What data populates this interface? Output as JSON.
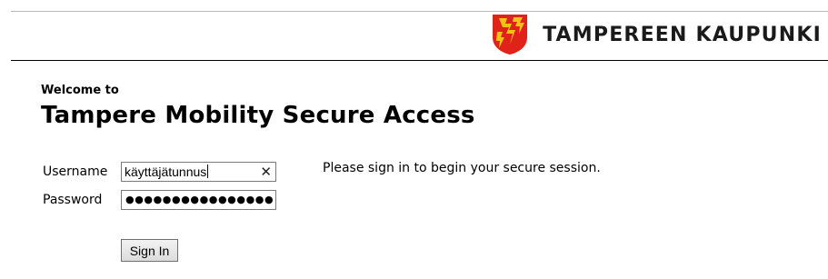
{
  "header": {
    "brand_name": "TAMPEREEN KAUPUNKI",
    "crest_icon": "tampere-crest-icon",
    "crest_colors": {
      "red": "#e1221b",
      "yellow": "#f2c314"
    }
  },
  "welcome": {
    "subtitle": "Welcome to",
    "title": "Tampere Mobility Secure Access"
  },
  "form": {
    "username_label": "Username",
    "username_value": "käyttäjätunnus",
    "clear_icon_glyph": "✕",
    "password_label": "Password",
    "password_masked": "●●●●●●●●●●●●●●●●",
    "signin_label": "Sign In"
  },
  "info": {
    "message": "Please sign in to begin your secure session."
  }
}
